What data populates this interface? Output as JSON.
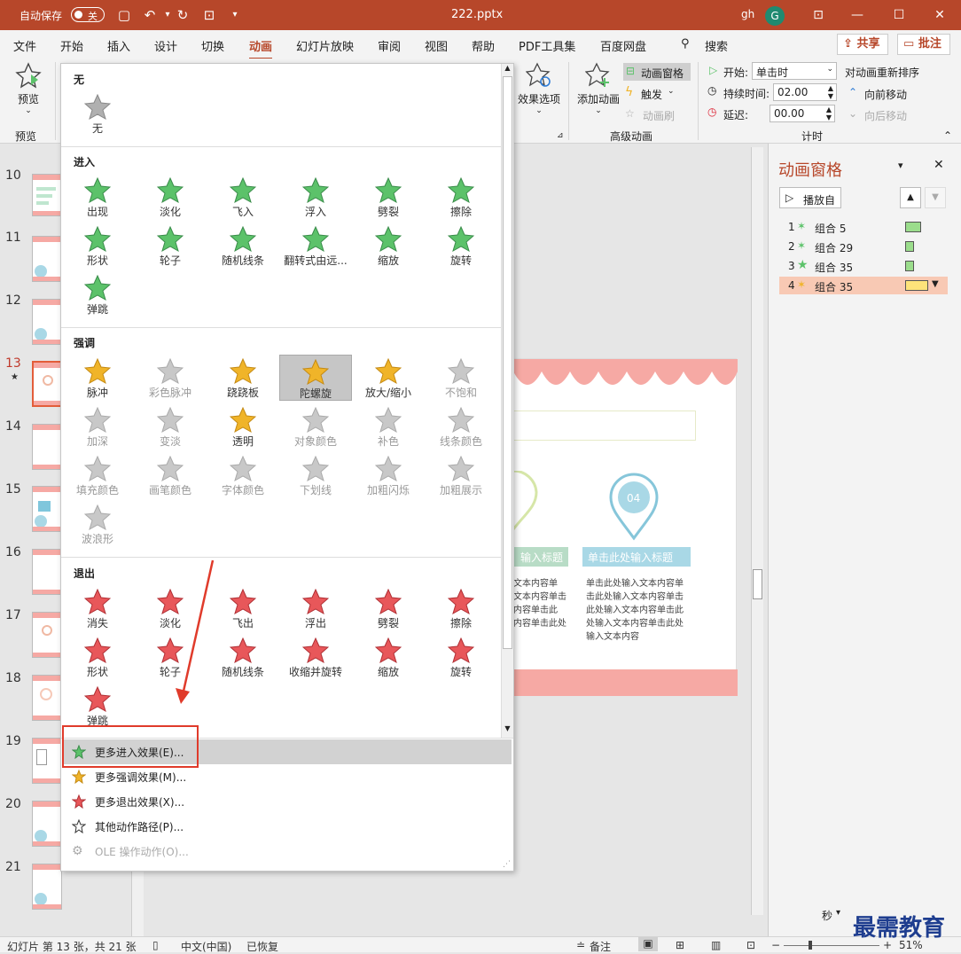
{
  "titlebar": {
    "autosave_label": "自动保存",
    "autosave_state": "关",
    "doc_title": "222.pptx",
    "user": "gh",
    "avatar_initial": "G"
  },
  "menu": {
    "tabs": [
      "文件",
      "开始",
      "插入",
      "设计",
      "切换",
      "动画",
      "幻灯片放映",
      "审阅",
      "视图",
      "帮助",
      "PDF工具集",
      "百度网盘"
    ],
    "active_tab": "动画",
    "search": "搜索",
    "share": "共享",
    "comment": "批注"
  },
  "ribbon": {
    "preview": "预览",
    "preview_group": "预览",
    "effect_options": "效果选项",
    "add_animation": "添加动画",
    "anim_pane_btn": "动画窗格",
    "trigger": "触发",
    "anim_painter": "动画刷",
    "advanced_group": "高级动画",
    "start_label": "开始:",
    "start_value": "单击时",
    "duration_label": "持续时间:",
    "duration_value": "02.00",
    "delay_label": "延迟:",
    "delay_value": "00.00",
    "reorder_label": "对动画重新排序",
    "move_earlier": "向前移动",
    "move_later": "向后移动",
    "timing_group": "计时"
  },
  "gallery": {
    "none_title": "无",
    "none_item": "无",
    "entrance_title": "进入",
    "entrance": [
      "出现",
      "淡化",
      "飞入",
      "浮入",
      "劈裂",
      "擦除",
      "形状",
      "轮子",
      "随机线条",
      "翻转式由远...",
      "缩放",
      "旋转",
      "弹跳"
    ],
    "emphasis_title": "强调",
    "emphasis": [
      "脉冲",
      "彩色脉冲",
      "跷跷板",
      "陀螺旋",
      "放大/缩小",
      "不饱和",
      "加深",
      "变淡",
      "透明",
      "对象颜色",
      "补色",
      "线条颜色",
      "填充颜色",
      "画笔颜色",
      "字体颜色",
      "下划线",
      "加粗闪烁",
      "加粗展示",
      "波浪形"
    ],
    "exit_title": "退出",
    "exit": [
      "消失",
      "淡化",
      "飞出",
      "浮出",
      "劈裂",
      "擦除",
      "形状",
      "轮子",
      "随机线条",
      "收缩并旋转",
      "缩放",
      "旋转",
      "弹跳"
    ],
    "menu": [
      "更多进入效果(E)...",
      "更多强调效果(M)...",
      "更多退出效果(X)...",
      "其他动作路径(P)...",
      "OLE 操作动作(O)..."
    ]
  },
  "slides": [
    "10",
    "11",
    "12",
    "13",
    "14",
    "15",
    "16",
    "17",
    "18",
    "19",
    "20",
    "21"
  ],
  "slide": {
    "pin_number": "04",
    "left_caption": "输入标题",
    "right_caption": "单击此处输入标题",
    "left_body": [
      "文本内容单",
      "文本内容单击",
      "内容单击此",
      "内容单击此处"
    ],
    "right_body": [
      "单击此处输入文本内容单",
      "击此处输入文本内容单击",
      "此处输入文本内容单击此",
      "处输入文本内容单击此处",
      "输入文本内容"
    ]
  },
  "anim_pane": {
    "title": "动画窗格",
    "play": "播放自",
    "items": [
      {
        "num": "1",
        "label": "组合 5"
      },
      {
        "num": "2",
        "label": "组合 29"
      },
      {
        "num": "3",
        "label": "组合 35"
      },
      {
        "num": "4",
        "label": "组合 35"
      }
    ],
    "seconds": "秒"
  },
  "status": {
    "slide_info": "幻灯片 第 13 张，共 21 张",
    "lang": "中文(中国)",
    "recovered": "已恢复",
    "notes": "备注",
    "zoom": "51%"
  },
  "watermark": "最需教育",
  "colors": {
    "brand": "#b7472a",
    "green_star": "#5cc26a",
    "gold_star": "#f0b429",
    "red_star": "#e8575a",
    "gray_star": "#b0b0b0"
  }
}
